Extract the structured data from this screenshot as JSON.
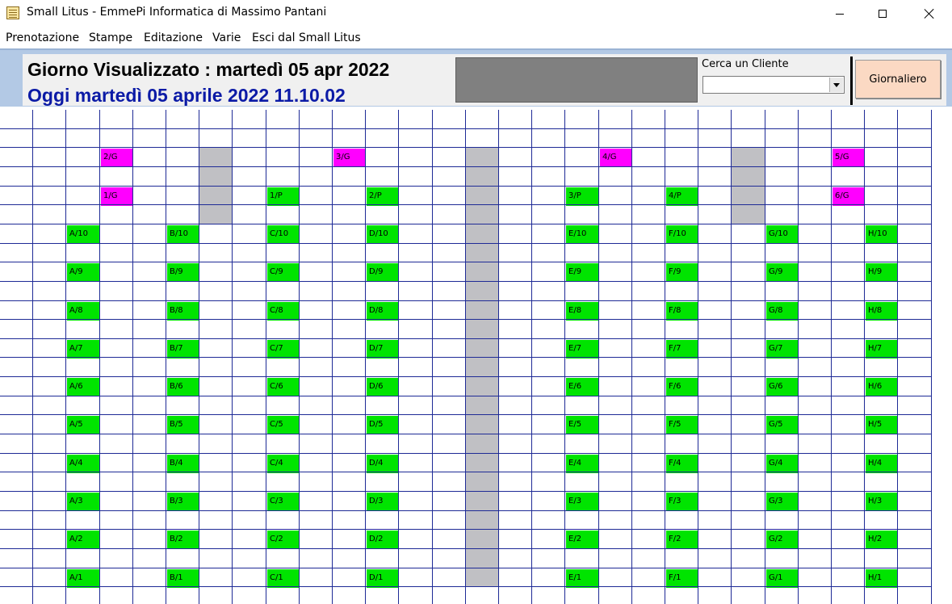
{
  "window": {
    "title": "Small Litus - EmmePi Informatica di Massimo Pantani",
    "app_icon": "notepad-icon",
    "controls": [
      "minimize-icon",
      "maximize-icon",
      "close-icon"
    ]
  },
  "menu": [
    "Prenotazione",
    "Stampe",
    "Editazione",
    "Varie",
    "Esci dal Small Litus"
  ],
  "header": {
    "day_label": "Giorno Visualizzato : martedì 05 apr 2022",
    "today_label": "Oggi martedì 05 aprile 2022 11.10.02",
    "search_label": "Cerca un Cliente",
    "search_value": "",
    "daily_button": "Giornaliero"
  },
  "colors": {
    "header_band": "#b3c9e5",
    "grid_line": "#1e2a96",
    "umbrella_slot": "#00e400",
    "gazebo_slot": "#ff00ff",
    "blocked": "#c0c0c4",
    "today_text": "#0b1aa6",
    "daily_button": "#fbd9c3"
  },
  "grid": {
    "columns": 28,
    "rows": 26,
    "blocked_cells": [
      {
        "col": 6,
        "row_start": 2,
        "row_end": 6
      },
      {
        "col": 14,
        "row_start": 2,
        "row_end": 25
      },
      {
        "col": 22,
        "row_start": 2,
        "row_end": 6
      }
    ],
    "slots": [
      {
        "label": "2/G",
        "col": 3,
        "row": 2,
        "kind": "magenta"
      },
      {
        "label": "3/G",
        "col": 10,
        "row": 2,
        "kind": "magenta"
      },
      {
        "label": "4/G",
        "col": 18,
        "row": 2,
        "kind": "magenta"
      },
      {
        "label": "5/G",
        "col": 25,
        "row": 2,
        "kind": "magenta"
      },
      {
        "label": "1/G",
        "col": 3,
        "row": 4,
        "kind": "magenta"
      },
      {
        "label": "1/P",
        "col": 8,
        "row": 4,
        "kind": "green"
      },
      {
        "label": "2/P",
        "col": 11,
        "row": 4,
        "kind": "green"
      },
      {
        "label": "3/P",
        "col": 17,
        "row": 4,
        "kind": "green"
      },
      {
        "label": "4/P",
        "col": 20,
        "row": 4,
        "kind": "green"
      },
      {
        "label": "6/G",
        "col": 25,
        "row": 4,
        "kind": "magenta"
      },
      {
        "label": "A/10",
        "col": 2,
        "row": 6,
        "kind": "green"
      },
      {
        "label": "B/10",
        "col": 5,
        "row": 6,
        "kind": "green"
      },
      {
        "label": "C/10",
        "col": 8,
        "row": 6,
        "kind": "green"
      },
      {
        "label": "D/10",
        "col": 11,
        "row": 6,
        "kind": "green"
      },
      {
        "label": "E/10",
        "col": 17,
        "row": 6,
        "kind": "green"
      },
      {
        "label": "F/10",
        "col": 20,
        "row": 6,
        "kind": "green"
      },
      {
        "label": "G/10",
        "col": 23,
        "row": 6,
        "kind": "green"
      },
      {
        "label": "H/10",
        "col": 26,
        "row": 6,
        "kind": "green"
      },
      {
        "label": "A/9",
        "col": 2,
        "row": 8,
        "kind": "green"
      },
      {
        "label": "B/9",
        "col": 5,
        "row": 8,
        "kind": "green"
      },
      {
        "label": "C/9",
        "col": 8,
        "row": 8,
        "kind": "green"
      },
      {
        "label": "D/9",
        "col": 11,
        "row": 8,
        "kind": "green"
      },
      {
        "label": "E/9",
        "col": 17,
        "row": 8,
        "kind": "green"
      },
      {
        "label": "F/9",
        "col": 20,
        "row": 8,
        "kind": "green"
      },
      {
        "label": "G/9",
        "col": 23,
        "row": 8,
        "kind": "green"
      },
      {
        "label": "H/9",
        "col": 26,
        "row": 8,
        "kind": "green"
      },
      {
        "label": "A/8",
        "col": 2,
        "row": 10,
        "kind": "green"
      },
      {
        "label": "B/8",
        "col": 5,
        "row": 10,
        "kind": "green"
      },
      {
        "label": "C/8",
        "col": 8,
        "row": 10,
        "kind": "green"
      },
      {
        "label": "D/8",
        "col": 11,
        "row": 10,
        "kind": "green"
      },
      {
        "label": "E/8",
        "col": 17,
        "row": 10,
        "kind": "green"
      },
      {
        "label": "F/8",
        "col": 20,
        "row": 10,
        "kind": "green"
      },
      {
        "label": "G/8",
        "col": 23,
        "row": 10,
        "kind": "green"
      },
      {
        "label": "H/8",
        "col": 26,
        "row": 10,
        "kind": "green"
      },
      {
        "label": "A/7",
        "col": 2,
        "row": 12,
        "kind": "green"
      },
      {
        "label": "B/7",
        "col": 5,
        "row": 12,
        "kind": "green"
      },
      {
        "label": "C/7",
        "col": 8,
        "row": 12,
        "kind": "green"
      },
      {
        "label": "D/7",
        "col": 11,
        "row": 12,
        "kind": "green"
      },
      {
        "label": "E/7",
        "col": 17,
        "row": 12,
        "kind": "green"
      },
      {
        "label": "F/7",
        "col": 20,
        "row": 12,
        "kind": "green"
      },
      {
        "label": "G/7",
        "col": 23,
        "row": 12,
        "kind": "green"
      },
      {
        "label": "H/7",
        "col": 26,
        "row": 12,
        "kind": "green"
      },
      {
        "label": "A/6",
        "col": 2,
        "row": 14,
        "kind": "green"
      },
      {
        "label": "B/6",
        "col": 5,
        "row": 14,
        "kind": "green"
      },
      {
        "label": "C/6",
        "col": 8,
        "row": 14,
        "kind": "green"
      },
      {
        "label": "D/6",
        "col": 11,
        "row": 14,
        "kind": "green"
      },
      {
        "label": "E/6",
        "col": 17,
        "row": 14,
        "kind": "green"
      },
      {
        "label": "F/6",
        "col": 20,
        "row": 14,
        "kind": "green"
      },
      {
        "label": "G/6",
        "col": 23,
        "row": 14,
        "kind": "green"
      },
      {
        "label": "H/6",
        "col": 26,
        "row": 14,
        "kind": "green"
      },
      {
        "label": "A/5",
        "col": 2,
        "row": 16,
        "kind": "green"
      },
      {
        "label": "B/5",
        "col": 5,
        "row": 16,
        "kind": "green"
      },
      {
        "label": "C/5",
        "col": 8,
        "row": 16,
        "kind": "green"
      },
      {
        "label": "D/5",
        "col": 11,
        "row": 16,
        "kind": "green"
      },
      {
        "label": "E/5",
        "col": 17,
        "row": 16,
        "kind": "green"
      },
      {
        "label": "F/5",
        "col": 20,
        "row": 16,
        "kind": "green"
      },
      {
        "label": "G/5",
        "col": 23,
        "row": 16,
        "kind": "green"
      },
      {
        "label": "H/5",
        "col": 26,
        "row": 16,
        "kind": "green"
      },
      {
        "label": "A/4",
        "col": 2,
        "row": 18,
        "kind": "green"
      },
      {
        "label": "B/4",
        "col": 5,
        "row": 18,
        "kind": "green"
      },
      {
        "label": "C/4",
        "col": 8,
        "row": 18,
        "kind": "green"
      },
      {
        "label": "D/4",
        "col": 11,
        "row": 18,
        "kind": "green"
      },
      {
        "label": "E/4",
        "col": 17,
        "row": 18,
        "kind": "green"
      },
      {
        "label": "F/4",
        "col": 20,
        "row": 18,
        "kind": "green"
      },
      {
        "label": "G/4",
        "col": 23,
        "row": 18,
        "kind": "green"
      },
      {
        "label": "H/4",
        "col": 26,
        "row": 18,
        "kind": "green"
      },
      {
        "label": "A/3",
        "col": 2,
        "row": 20,
        "kind": "green"
      },
      {
        "label": "B/3",
        "col": 5,
        "row": 20,
        "kind": "green"
      },
      {
        "label": "C/3",
        "col": 8,
        "row": 20,
        "kind": "green"
      },
      {
        "label": "D/3",
        "col": 11,
        "row": 20,
        "kind": "green"
      },
      {
        "label": "E/3",
        "col": 17,
        "row": 20,
        "kind": "green"
      },
      {
        "label": "F/3",
        "col": 20,
        "row": 20,
        "kind": "green"
      },
      {
        "label": "G/3",
        "col": 23,
        "row": 20,
        "kind": "green"
      },
      {
        "label": "H/3",
        "col": 26,
        "row": 20,
        "kind": "green"
      },
      {
        "label": "A/2",
        "col": 2,
        "row": 22,
        "kind": "green"
      },
      {
        "label": "B/2",
        "col": 5,
        "row": 22,
        "kind": "green"
      },
      {
        "label": "C/2",
        "col": 8,
        "row": 22,
        "kind": "green"
      },
      {
        "label": "D/2",
        "col": 11,
        "row": 22,
        "kind": "green"
      },
      {
        "label": "E/2",
        "col": 17,
        "row": 22,
        "kind": "green"
      },
      {
        "label": "F/2",
        "col": 20,
        "row": 22,
        "kind": "green"
      },
      {
        "label": "G/2",
        "col": 23,
        "row": 22,
        "kind": "green"
      },
      {
        "label": "H/2",
        "col": 26,
        "row": 22,
        "kind": "green"
      },
      {
        "label": "A/1",
        "col": 2,
        "row": 24,
        "kind": "green"
      },
      {
        "label": "B/1",
        "col": 5,
        "row": 24,
        "kind": "green"
      },
      {
        "label": "C/1",
        "col": 8,
        "row": 24,
        "kind": "green"
      },
      {
        "label": "D/1",
        "col": 11,
        "row": 24,
        "kind": "green"
      },
      {
        "label": "E/1",
        "col": 17,
        "row": 24,
        "kind": "green"
      },
      {
        "label": "F/1",
        "col": 20,
        "row": 24,
        "kind": "green"
      },
      {
        "label": "G/1",
        "col": 23,
        "row": 24,
        "kind": "green"
      },
      {
        "label": "H/1",
        "col": 26,
        "row": 24,
        "kind": "green"
      }
    ]
  }
}
